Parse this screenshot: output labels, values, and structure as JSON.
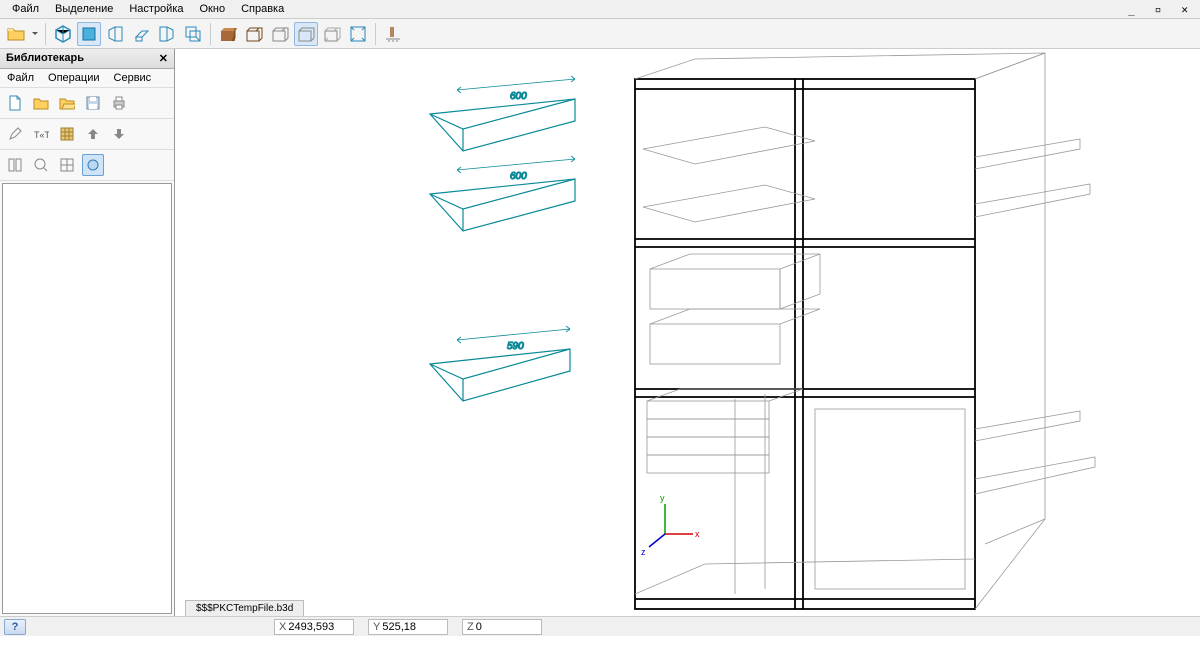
{
  "menu": {
    "file": "Файл",
    "select": "Выделение",
    "settings": "Настройка",
    "window": "Окно",
    "help": "Справка"
  },
  "wctrl": {
    "min": "_",
    "max": "▫",
    "close": "✕"
  },
  "panel": {
    "title": "Библиотекарь"
  },
  "side_menu": {
    "file": "Файл",
    "ops": "Операции",
    "service": "Сервис"
  },
  "tab": {
    "file": "$$$PKCTempFile.b3d"
  },
  "status": {
    "x_label": "X",
    "x_val": "2493,593",
    "y_label": "Y",
    "y_val": "525,18",
    "z_label": "Z",
    "z_val": "0"
  },
  "dims": {
    "d1": "600",
    "d2": "600",
    "d3": "590"
  }
}
